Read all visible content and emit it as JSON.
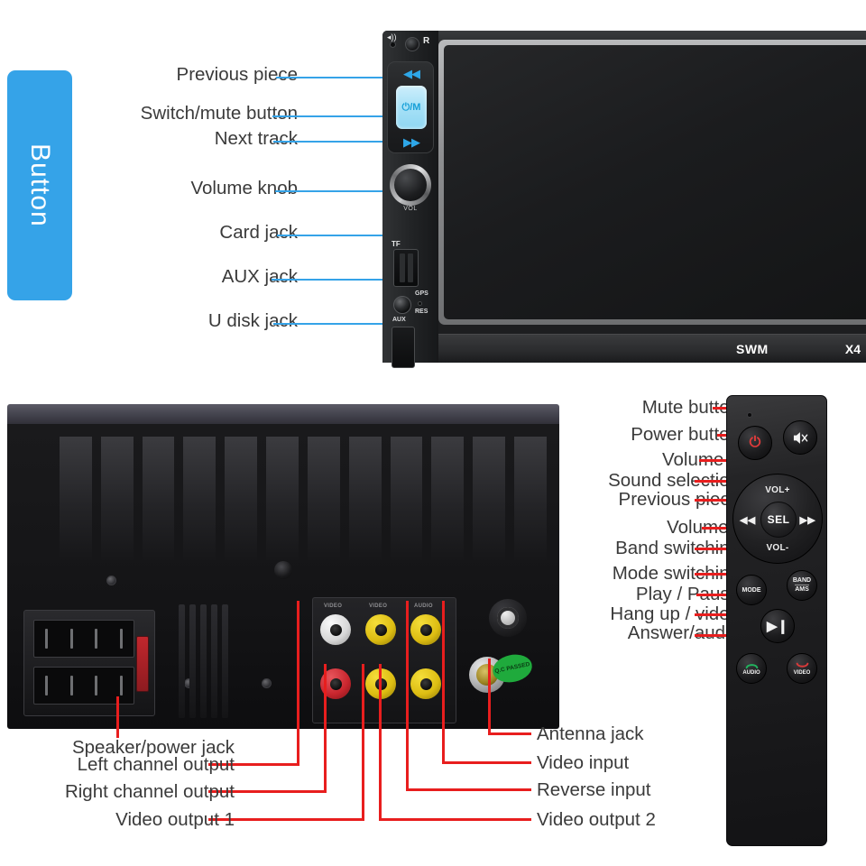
{
  "colors": {
    "blue": "#35a3e8",
    "red": "#e81e1e",
    "text": "#3a3a3a"
  },
  "side_tab": {
    "label": "Button"
  },
  "face_panel": {
    "brand": "SWM",
    "model": "X4",
    "port_captions": {
      "tf": "TF",
      "gps": "GPS",
      "res": "RES",
      "aux": "AUX",
      "vol": "VOL",
      "r_mark": "R"
    },
    "power_key_label": "⏻/M",
    "prev_glyph": "◀◀",
    "next_glyph": "▶▶",
    "callouts": [
      {
        "label": "Previous piece"
      },
      {
        "label": "Switch/mute button"
      },
      {
        "label": "Next track"
      },
      {
        "label": "Volume knob"
      },
      {
        "label": "Card jack"
      },
      {
        "label": "AUX jack"
      },
      {
        "label": "U disk jack"
      }
    ]
  },
  "rear_panel": {
    "qc_sticker": "Q.C PASSED",
    "rca_captions": {
      "c1": "VIDEO",
      "c2": "VIDEO",
      "c3": "AUDIO"
    },
    "callouts_left": [
      {
        "label": "Speaker/power jack"
      },
      {
        "label": "Left channel output"
      },
      {
        "label": "Right channel output"
      },
      {
        "label": "Video output 1"
      }
    ],
    "callouts_right": [
      {
        "label": "Antenna jack"
      },
      {
        "label": "Video input"
      },
      {
        "label": "Reverse input"
      },
      {
        "label": "Video output 2"
      }
    ]
  },
  "remote": {
    "buttons": {
      "power": "⏻",
      "mute": "mute-speaker",
      "vol_up": "VOL+",
      "vol_down": "VOL-",
      "sel": "SEL",
      "prev": "◀◀",
      "next": "▶▶",
      "mode": "MODE",
      "band": "BAND",
      "band_sub": "AMS",
      "play_pause": "▶❙",
      "audio": "AUDIO",
      "video": "VIDEO"
    },
    "callouts": [
      {
        "label": "Mute button"
      },
      {
        "label": "Power button"
      },
      {
        "label": "Volume +"
      },
      {
        "label": "Sound selection"
      },
      {
        "label": "Previous piece"
      },
      {
        "label": "Volume -"
      },
      {
        "label": "Band switching"
      },
      {
        "label": "Mode switching"
      },
      {
        "label": "Play / Pause"
      },
      {
        "label": "Hang up / video"
      },
      {
        "label": "Answer/audio"
      }
    ]
  }
}
